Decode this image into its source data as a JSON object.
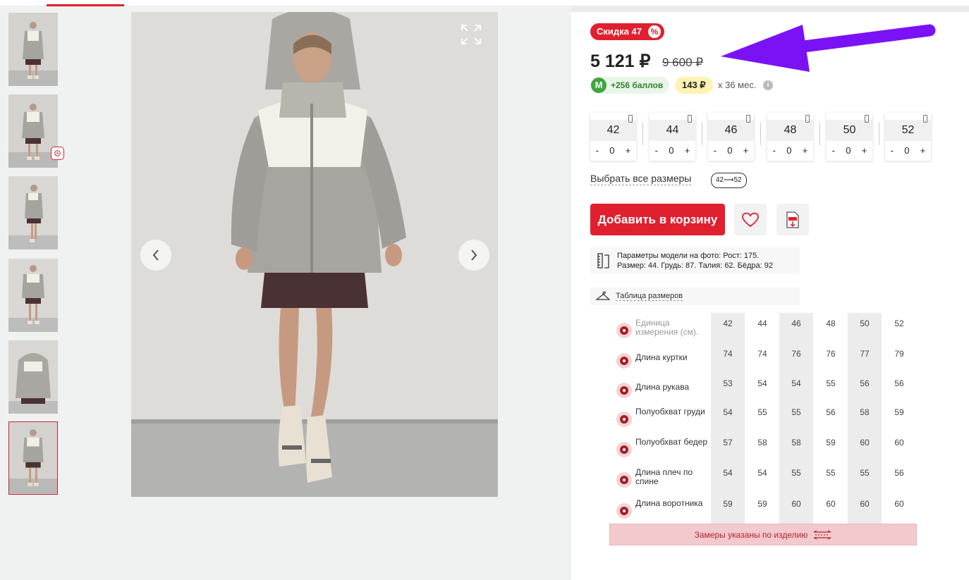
{
  "thumbnails": [
    {
      "name": "thumb-1"
    },
    {
      "name": "thumb-2"
    },
    {
      "name": "thumb-3"
    },
    {
      "name": "thumb-4"
    },
    {
      "name": "thumb-5"
    },
    {
      "name": "thumb-6"
    }
  ],
  "icons": {
    "video": "video-play-icon",
    "expand": "expand-icon",
    "prev": "chevron-left-icon",
    "next": "chevron-right-icon",
    "favorite": "heart-icon",
    "pdf": "pdf-download-icon",
    "ruler": "ruler-icon",
    "hanger": "hanger-icon",
    "info": "info-icon",
    "measure": "measure-tape-icon",
    "phone": "phone-icon"
  },
  "colors": {
    "accent": "#e0202f",
    "points_green": "#3ea63d",
    "installment_yellow": "#fff3b3",
    "arrow": "#7a12f5"
  },
  "product": {
    "discount_label": "Скидка 47",
    "discount_icon": "%",
    "price": "5 121 ₽",
    "old_price": "9 600 ₽",
    "points_letter": "M",
    "points": "+256 баллов",
    "installment": "143 ₽",
    "installment_term": "x 36 мес.",
    "info_glyph": "i"
  },
  "sizes": [
    {
      "size": "42",
      "minus": "-",
      "qty": "0",
      "plus": "+"
    },
    {
      "size": "44",
      "minus": "-",
      "qty": "0",
      "plus": "+"
    },
    {
      "size": "46",
      "minus": "-",
      "qty": "0",
      "plus": "+"
    },
    {
      "size": "48",
      "minus": "-",
      "qty": "0",
      "plus": "+"
    },
    {
      "size": "50",
      "minus": "-",
      "qty": "0",
      "plus": "+"
    },
    {
      "size": "52",
      "minus": "-",
      "qty": "0",
      "plus": "+"
    }
  ],
  "select_all_sizes": "Выбрать все размеры",
  "size_range_chip": "42⟶52",
  "actions": {
    "add_to_cart": "Добавить в корзину"
  },
  "model_params": {
    "line1": "Параметры модели на фото: Рост: 175.",
    "line2": "Размер: 44. Грудь: 87. Талия: 62. Бёдра: 92"
  },
  "size_table_link": "Таблица размеров",
  "size_table": {
    "rows": [
      {
        "label": "Единица измерения (см).",
        "values": [
          "42",
          "44",
          "46",
          "48",
          "50",
          "52"
        ]
      },
      {
        "label": "Длина куртки",
        "values": [
          "74",
          "74",
          "76",
          "76",
          "77",
          "79"
        ]
      },
      {
        "label": "Длина рукава",
        "values": [
          "53",
          "54",
          "54",
          "55",
          "56",
          "56"
        ]
      },
      {
        "label": "Полуобхват груди",
        "values": [
          "54",
          "55",
          "55",
          "56",
          "58",
          "59"
        ]
      },
      {
        "label": "Полуобхват бедер",
        "values": [
          "57",
          "58",
          "58",
          "59",
          "60",
          "60"
        ]
      },
      {
        "label": "Длина плеч по спине",
        "values": [
          "54",
          "54",
          "55",
          "55",
          "55",
          "56"
        ]
      },
      {
        "label": "Длина воротника",
        "values": [
          "59",
          "59",
          "60",
          "60",
          "60",
          "60"
        ]
      }
    ]
  },
  "measure_note": "Замеры указаны по изделию"
}
